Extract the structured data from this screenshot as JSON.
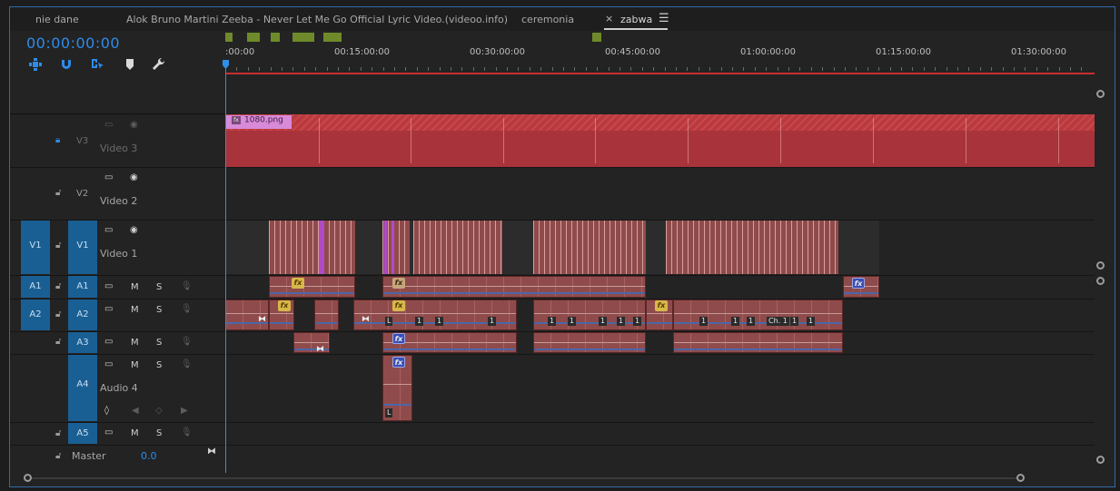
{
  "tabs": [
    {
      "label": "nie dane",
      "active": false
    },
    {
      "label": "Alok Bruno Martini Zeeba - Never Let Me Go Official Lyric Video.(videoo.info)",
      "active": false
    },
    {
      "label": "ceremonia",
      "active": false
    },
    {
      "label": "zabwa",
      "active": true
    }
  ],
  "tab_close_glyph": "×",
  "tab_menu_glyph": "☰",
  "timecode": "00:00:00:00",
  "ruler_labels": [
    ":00:00",
    "00:15:00:00",
    "00:30:00:00",
    "00:45:00:00",
    "01:00:00:00",
    "01:15:00:00",
    "01:30:00:00"
  ],
  "tracks": {
    "v3": {
      "target": "V3",
      "name": "Video 3"
    },
    "v2": {
      "target": "V2",
      "name": "Video 2"
    },
    "v1": {
      "source": "V1",
      "target": "V1",
      "name": "Video 1"
    },
    "a1": {
      "source": "A1",
      "target": "A1",
      "m": "M",
      "s": "S"
    },
    "a2": {
      "source": "A2",
      "target": "A2",
      "m": "M",
      "s": "S"
    },
    "a3": {
      "target": "A3",
      "m": "M",
      "s": "S"
    },
    "a4": {
      "target": "A4",
      "name": "Audio 4",
      "m": "M",
      "s": "S"
    },
    "a5": {
      "target": "A5",
      "m": "M",
      "s": "S"
    },
    "master": {
      "name": "Master",
      "value": "0.0"
    }
  },
  "clip_labels": {
    "png_clip": "1080.png",
    "fx": "fx",
    "ch": "Ch. 1",
    "one": "1",
    "l": "L"
  },
  "colors": {
    "accent_blue": "#2d8ceb",
    "track_target": "#1a5f93",
    "clip_red": "#8f4b4b",
    "work_area": "#c8302f",
    "marker_green": "#6f8a2a"
  }
}
